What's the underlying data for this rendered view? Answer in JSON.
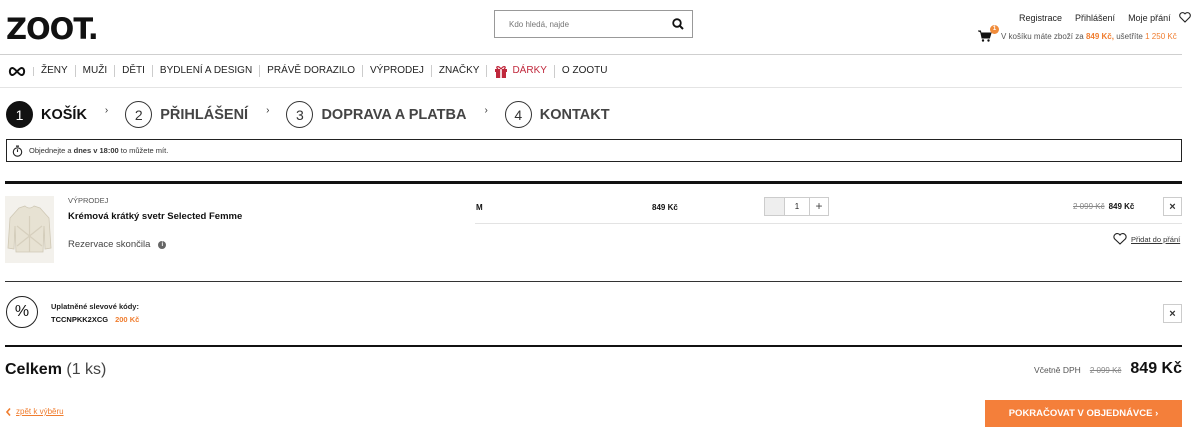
{
  "header": {
    "logo": "ZOOT.",
    "search_placeholder": "Kdo hledá, najde",
    "links": {
      "register": "Registrace",
      "login": "Přihlášení",
      "wishlist": "Moje přání"
    },
    "cart_badge": "1",
    "cart_text_prefix": "V košíku máte zboží za",
    "cart_total": "849 Kč,",
    "cart_saved_label": "ušetříte",
    "cart_saved": "1 250 Kč"
  },
  "nav": {
    "items": [
      "ŽENY",
      "MUŽI",
      "DĚTI",
      "BYDLENÍ A DESIGN",
      "PRÁVĚ DORAZILO",
      "VÝPRODEJ",
      "ZNAČKY",
      "DÁRKY",
      "O ZOOTU"
    ]
  },
  "steps": [
    {
      "num": "1",
      "label": "KOŠÍK"
    },
    {
      "num": "2",
      "label": "PŘIHLÁŠENÍ"
    },
    {
      "num": "3",
      "label": "DOPRAVA A PLATBA"
    },
    {
      "num": "4",
      "label": "KONTAKT"
    }
  ],
  "info": {
    "pre": "Objednejte a",
    "bold": "dnes v 18:00",
    "post": "to můžete mít."
  },
  "item": {
    "tag": "VÝPRODEJ",
    "name": "Krémová krátký svetr Selected Femme",
    "reservation": "Rezervace skončila",
    "size": "M",
    "unit_price": "849 Kč",
    "quantity": "1",
    "old_price": "2 099 Kč",
    "price": "849 Kč",
    "wishlist": "Přidat do přání"
  },
  "discount": {
    "title": "Uplatněné slevové kódy:",
    "code": "TCCNPKK2XCG",
    "amount": "200 Kč"
  },
  "summary": {
    "label": "Celkem",
    "count": "(1 ks)",
    "vat": "Včetně DPH",
    "old_price": "2 099 Kč",
    "price": "849 Kč"
  },
  "footer": {
    "back": "zpět k výběru",
    "continue": "POKRAČOVAT V OBJEDNÁVCE"
  },
  "colors": {
    "accent": "#f47f3a",
    "gift": "#c0283c"
  }
}
